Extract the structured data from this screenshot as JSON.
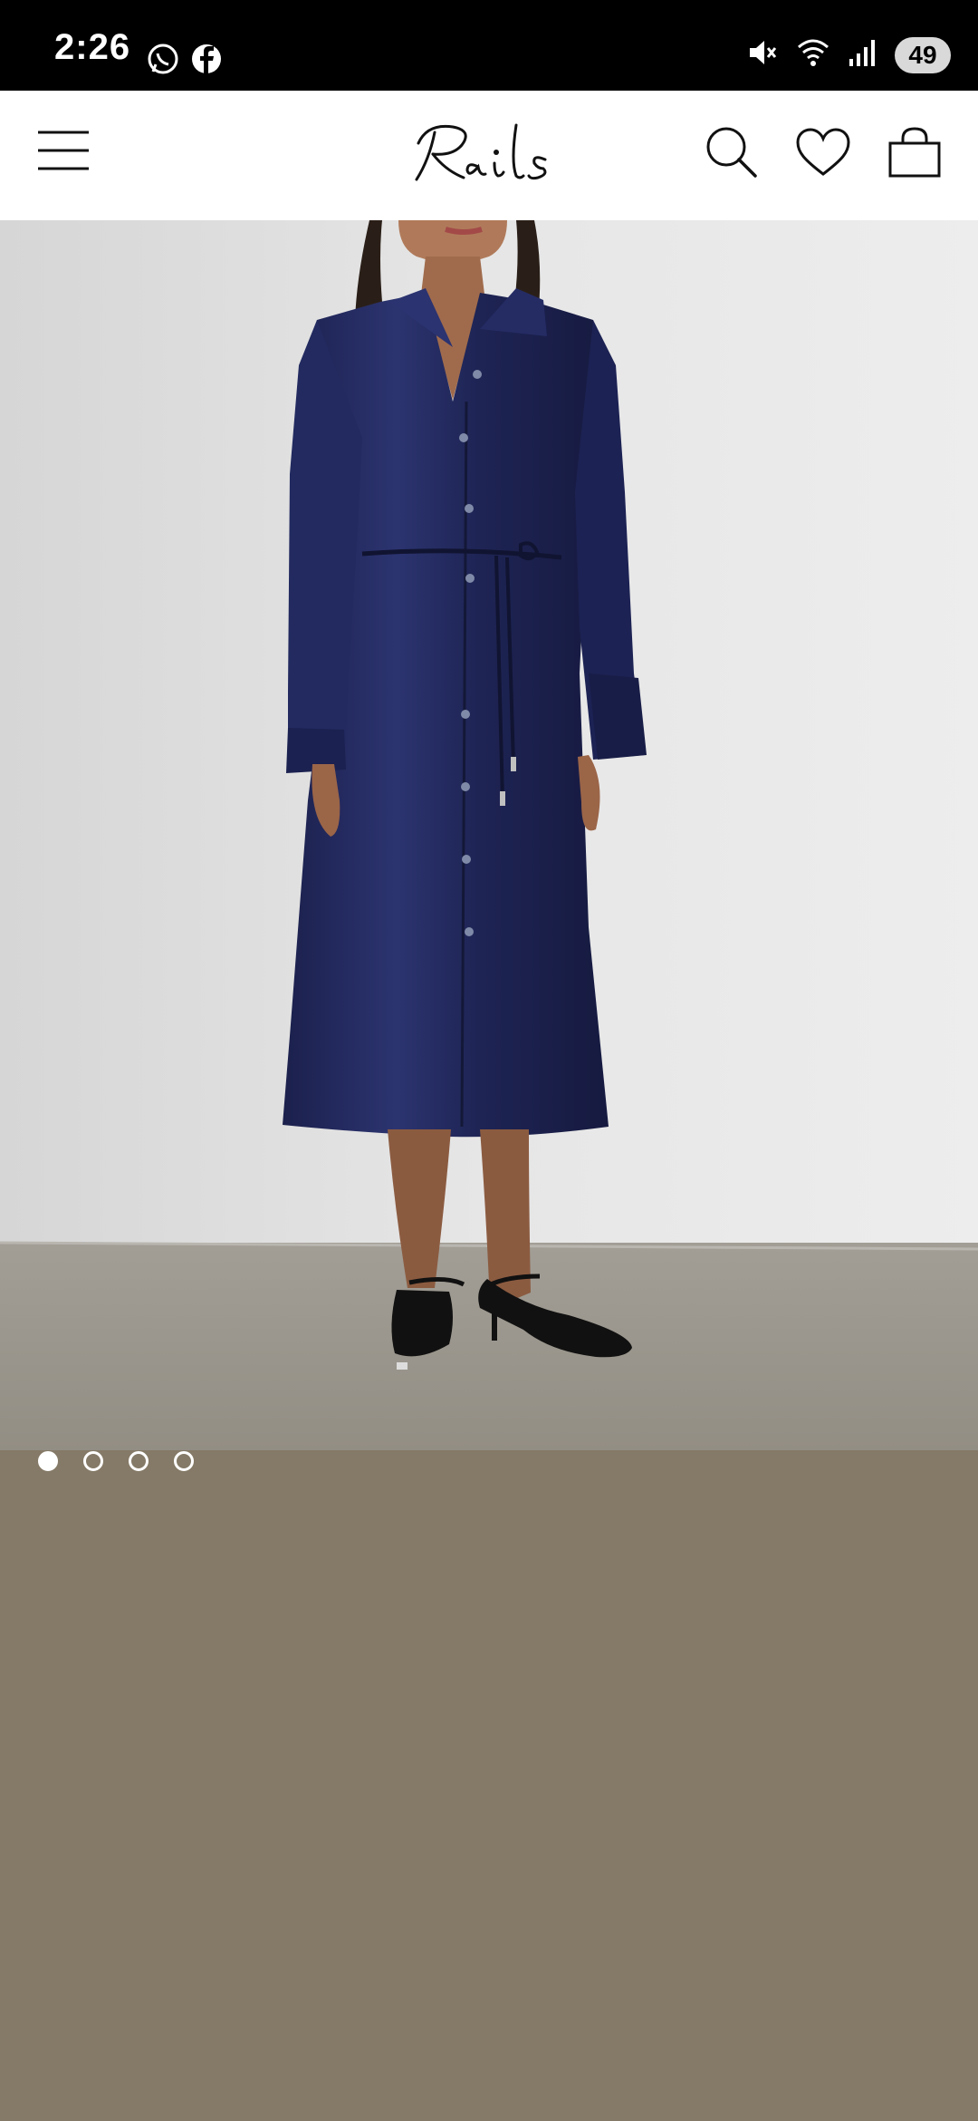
{
  "status_bar": {
    "time": "2:26",
    "battery": "49",
    "icons": [
      "whatsapp-icon",
      "facebook-icon",
      "mute-icon",
      "wifi-icon",
      "signal-icon"
    ]
  },
  "header": {
    "logo_text": "Rails",
    "icons": [
      "menu-icon",
      "search-icon",
      "heart-icon",
      "bag-icon"
    ]
  },
  "carousel": {
    "total_slides": 4,
    "active_index": 0
  },
  "colors": {
    "background": "#857a67",
    "dress": "#1e2454",
    "wall": "#e3e3e3",
    "floor": "#9b968d"
  }
}
